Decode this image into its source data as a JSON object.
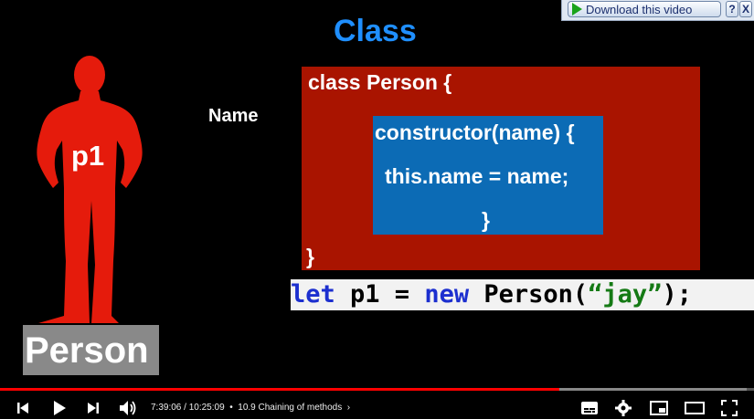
{
  "download_bar": {
    "button_label": "Download this video",
    "help_label": "?",
    "close_label": "X"
  },
  "slide": {
    "title": "Class",
    "name_label": "Name",
    "class_open": "class Person {",
    "class_close": "}",
    "constructor_open": "constructor(name) {",
    "constructor_body": "this.name = name;",
    "constructor_close": "}",
    "code": {
      "kw_let": "let",
      "var": " p1 = ",
      "kw_new": "new",
      "call_open": " Person(",
      "string": "“jay”",
      "call_close": ");"
    },
    "figure_label": "p1",
    "person_label": "Person"
  },
  "colors": {
    "title_blue": "#1f8fff",
    "class_red": "#a91400",
    "constructor_blue": "#0c6bb5",
    "figure_red": "#e51b0c",
    "progress_red": "#ff0000"
  },
  "player": {
    "progress_fraction": 0.742,
    "buffer_fraction": 0.99,
    "current_time": "7:39:06",
    "duration": "10:25:09",
    "separator": " / ",
    "chapter": "10.9 Chaining of methods",
    "icons": [
      "skip-previous-icon",
      "play-icon",
      "skip-next-icon",
      "volume-icon",
      "subtitles-icon",
      "settings-icon",
      "miniplayer-icon",
      "theater-mode-icon",
      "fullscreen-icon"
    ]
  }
}
